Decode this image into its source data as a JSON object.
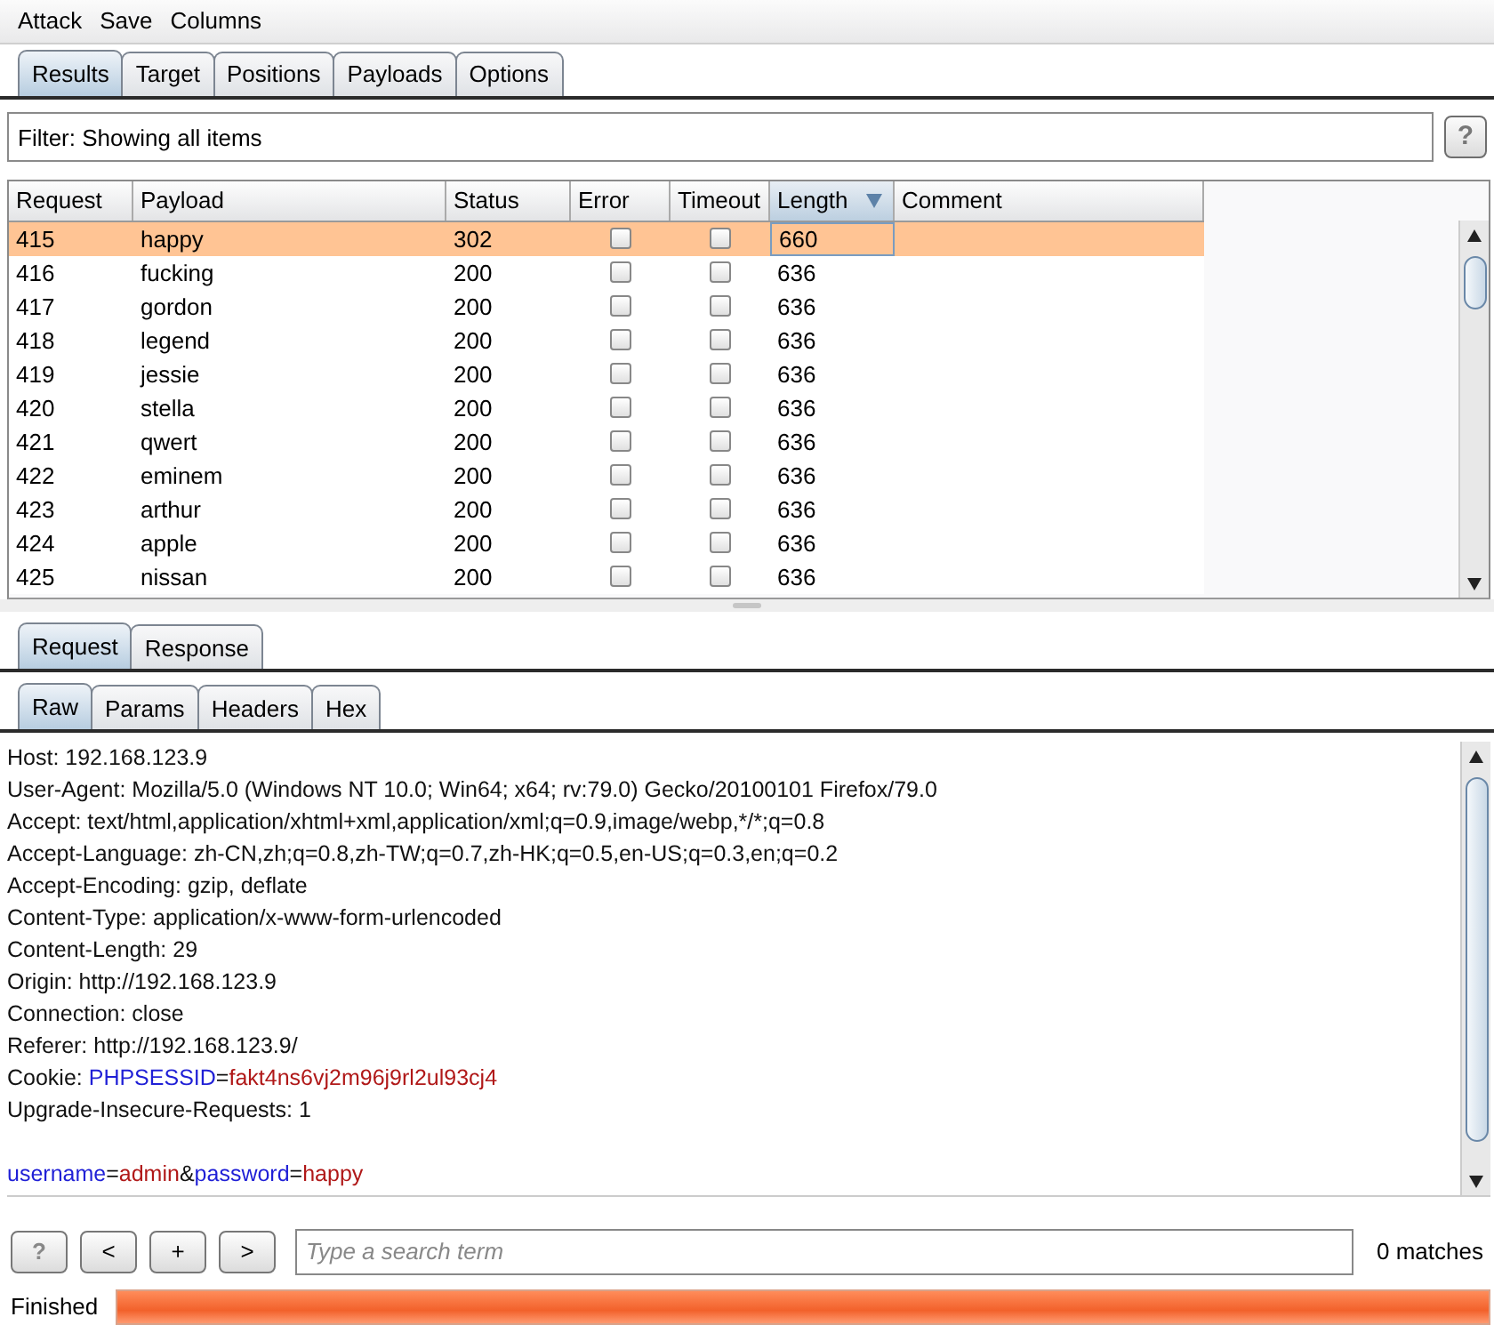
{
  "menu": [
    "Attack",
    "Save",
    "Columns"
  ],
  "tabs": [
    {
      "label": "Results",
      "selected": true
    },
    {
      "label": "Target",
      "selected": false
    },
    {
      "label": "Positions",
      "selected": false
    },
    {
      "label": "Payloads",
      "selected": false
    },
    {
      "label": "Options",
      "selected": false
    }
  ],
  "filter": {
    "text": "Filter: Showing all items",
    "help": "?"
  },
  "table": {
    "columns": [
      {
        "label": "Request",
        "sorted": false
      },
      {
        "label": "Payload",
        "sorted": false
      },
      {
        "label": "Status",
        "sorted": false
      },
      {
        "label": "Error",
        "sorted": false
      },
      {
        "label": "Timeout",
        "sorted": false
      },
      {
        "label": "Length",
        "sorted": true
      },
      {
        "label": "Comment",
        "sorted": false
      }
    ],
    "rows": [
      {
        "request": "415",
        "payload": "happy",
        "status": "302",
        "error": false,
        "timeout": false,
        "length": "660",
        "selected": true
      },
      {
        "request": "416",
        "payload": "fucking",
        "status": "200",
        "error": false,
        "timeout": false,
        "length": "636",
        "selected": false
      },
      {
        "request": "417",
        "payload": "gordon",
        "status": "200",
        "error": false,
        "timeout": false,
        "length": "636",
        "selected": false
      },
      {
        "request": "418",
        "payload": "legend",
        "status": "200",
        "error": false,
        "timeout": false,
        "length": "636",
        "selected": false
      },
      {
        "request": "419",
        "payload": "jessie",
        "status": "200",
        "error": false,
        "timeout": false,
        "length": "636",
        "selected": false
      },
      {
        "request": "420",
        "payload": "stella",
        "status": "200",
        "error": false,
        "timeout": false,
        "length": "636",
        "selected": false
      },
      {
        "request": "421",
        "payload": "qwert",
        "status": "200",
        "error": false,
        "timeout": false,
        "length": "636",
        "selected": false
      },
      {
        "request": "422",
        "payload": "eminem",
        "status": "200",
        "error": false,
        "timeout": false,
        "length": "636",
        "selected": false
      },
      {
        "request": "423",
        "payload": "arthur",
        "status": "200",
        "error": false,
        "timeout": false,
        "length": "636",
        "selected": false
      },
      {
        "request": "424",
        "payload": "apple",
        "status": "200",
        "error": false,
        "timeout": false,
        "length": "636",
        "selected": false
      },
      {
        "request": "425",
        "payload": "nissan",
        "status": "200",
        "error": false,
        "timeout": false,
        "length": "636",
        "selected": false
      }
    ]
  },
  "message_tabs": [
    {
      "label": "Request",
      "selected": true
    },
    {
      "label": "Response",
      "selected": false
    }
  ],
  "view_tabs": [
    {
      "label": "Raw",
      "selected": true
    },
    {
      "label": "Params",
      "selected": false
    },
    {
      "label": "Headers",
      "selected": false
    },
    {
      "label": "Hex",
      "selected": false
    }
  ],
  "headers": [
    [
      {
        "kind": "plain",
        "text": "Host: 192.168.123.9"
      }
    ],
    [
      {
        "kind": "plain",
        "text": "User-Agent: Mozilla/5.0 (Windows NT 10.0; Win64; x64; rv:79.0) Gecko/20100101 Firefox/79.0"
      }
    ],
    [
      {
        "kind": "plain",
        "text": "Accept: text/html,application/xhtml+xml,application/xml;q=0.9,image/webp,*/*;q=0.8"
      }
    ],
    [
      {
        "kind": "plain",
        "text": "Accept-Language: zh-CN,zh;q=0.8,zh-TW;q=0.7,zh-HK;q=0.5,en-US;q=0.3,en;q=0.2"
      }
    ],
    [
      {
        "kind": "plain",
        "text": "Accept-Encoding: gzip, deflate"
      }
    ],
    [
      {
        "kind": "plain",
        "text": "Content-Type: application/x-www-form-urlencoded"
      }
    ],
    [
      {
        "kind": "plain",
        "text": "Content-Length: 29"
      }
    ],
    [
      {
        "kind": "plain",
        "text": "Origin: http://192.168.123.9"
      }
    ],
    [
      {
        "kind": "plain",
        "text": "Connection: close"
      }
    ],
    [
      {
        "kind": "plain",
        "text": "Referer: http://192.168.123.9/"
      }
    ],
    [
      {
        "kind": "plain",
        "text": "Cookie: "
      },
      {
        "kind": "name",
        "text": "PHPSESSID"
      },
      {
        "kind": "plain",
        "text": "="
      },
      {
        "kind": "value",
        "text": "fakt4ns6vj2m96j9rl2ul93cj4"
      }
    ],
    [
      {
        "kind": "plain",
        "text": "Upgrade-Insecure-Requests: 1"
      }
    ]
  ],
  "body": [
    {
      "kind": "name",
      "text": "username"
    },
    {
      "kind": "plain",
      "text": "="
    },
    {
      "kind": "value",
      "text": "admin"
    },
    {
      "kind": "plain",
      "text": "&"
    },
    {
      "kind": "name",
      "text": "password"
    },
    {
      "kind": "plain",
      "text": "="
    },
    {
      "kind": "value",
      "text": "happy"
    }
  ],
  "search": {
    "buttons": [
      "?",
      "<",
      "+",
      ">"
    ],
    "placeholder": "Type a search term",
    "matches": "0 matches"
  },
  "status": {
    "text": "Finished",
    "level": 1
  }
}
